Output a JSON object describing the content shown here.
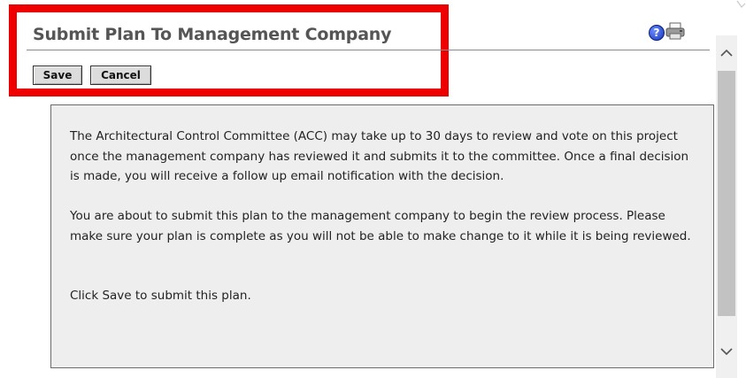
{
  "header": {
    "title": "Submit Plan To Management Company",
    "help_icon": "question-mark-icon",
    "print_icon": "printer-icon"
  },
  "toolbar": {
    "save_label": "Save",
    "cancel_label": "Cancel"
  },
  "content": {
    "paragraphs": [
      "The Architectural Control Committee (ACC) may take up to 30 days to review and vote on this project once the management company has reviewed it and submits it to the committee. Once a final decision is made, you will receive a follow up email notification with the decision.",
      "You are about to submit this plan to the management company to begin the review process. Please make sure your plan is complete as you will not be able to make change to it while it is being reviewed.",
      "Click Save to submit this plan."
    ]
  },
  "colors": {
    "highlight": "#ee0000",
    "content_background": "#eeeeee",
    "button_background": "#dcdcdc",
    "title_color": "#555555"
  }
}
